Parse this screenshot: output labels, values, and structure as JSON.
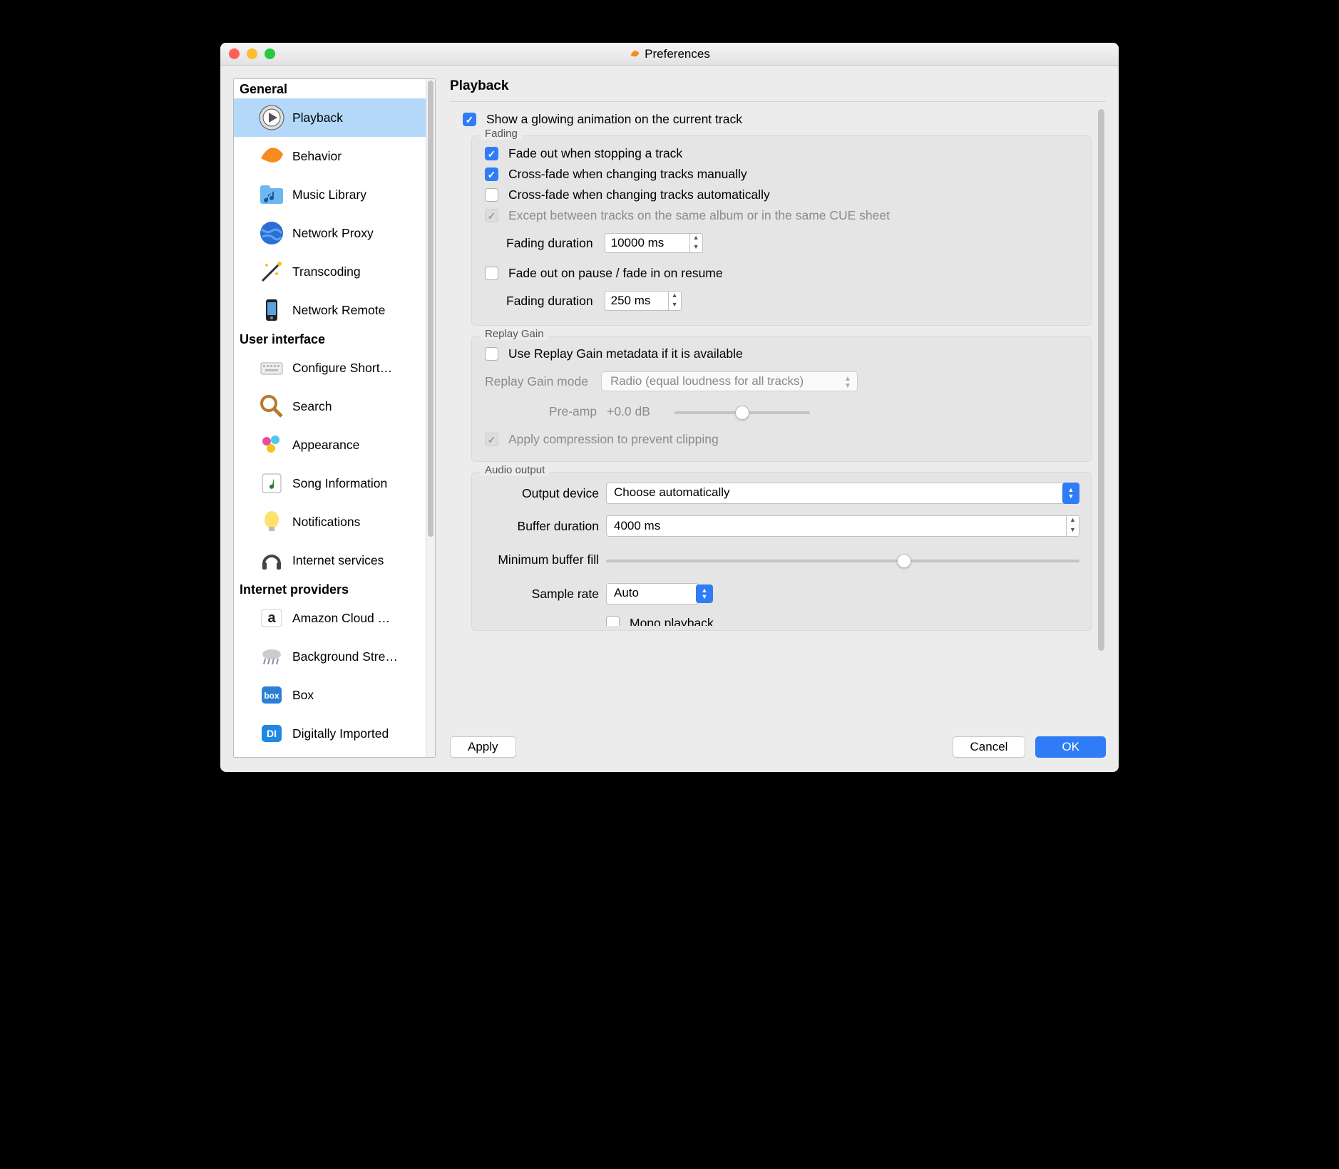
{
  "window": {
    "title": "Preferences"
  },
  "sidebar": {
    "cats": [
      {
        "name": "General",
        "items": [
          {
            "label": "Playback",
            "selected": true
          },
          {
            "label": "Behavior"
          },
          {
            "label": "Music Library"
          },
          {
            "label": "Network Proxy"
          },
          {
            "label": "Transcoding"
          },
          {
            "label": "Network Remote"
          }
        ]
      },
      {
        "name": "User interface",
        "items": [
          {
            "label": "Configure Short…"
          },
          {
            "label": "Search"
          },
          {
            "label": "Appearance"
          },
          {
            "label": "Song Information"
          },
          {
            "label": "Notifications"
          },
          {
            "label": "Internet services"
          }
        ]
      },
      {
        "name": "Internet providers",
        "items": [
          {
            "label": "Amazon Cloud …"
          },
          {
            "label": "Background Stre…"
          },
          {
            "label": "Box"
          },
          {
            "label": "Digitally Imported"
          }
        ]
      }
    ]
  },
  "main": {
    "title": "Playback",
    "glow": {
      "label": "Show a glowing animation on the current track",
      "checked": true
    },
    "fading": {
      "legend": "Fading",
      "stop": {
        "label": "Fade out when stopping a track",
        "checked": true
      },
      "man": {
        "label": "Cross-fade when changing tracks manually",
        "checked": true
      },
      "auto": {
        "label": "Cross-fade when changing tracks automatically",
        "checked": false
      },
      "except": {
        "label": "Except between tracks on the same album or in the same CUE sheet",
        "checked": true,
        "disabled": true
      },
      "dur1": {
        "label": "Fading duration",
        "value": "10000 ms"
      },
      "pause": {
        "label": "Fade out on pause / fade in on resume",
        "checked": false
      },
      "dur2": {
        "label": "Fading duration",
        "value": "250 ms"
      }
    },
    "replay": {
      "legend": "Replay Gain",
      "use": {
        "label": "Use Replay Gain metadata if it is available",
        "checked": false
      },
      "mode": {
        "label": "Replay Gain mode",
        "value": "Radio (equal loudness for all tracks)"
      },
      "preamp": {
        "label": "Pre-amp",
        "value": "+0.0 dB"
      },
      "slider_pos": 0.5,
      "comp": {
        "label": "Apply compression to prevent clipping",
        "checked": true,
        "disabled": true
      }
    },
    "audio": {
      "legend": "Audio output",
      "device": {
        "label": "Output device",
        "value": "Choose automatically"
      },
      "buffer": {
        "label": "Buffer duration",
        "value": "4000 ms"
      },
      "minfill": {
        "label": "Minimum buffer fill",
        "slider_pos": 0.63
      },
      "sample": {
        "label": "Sample rate",
        "value": "Auto"
      },
      "mono": {
        "label": "Mono playback",
        "checked": false
      }
    }
  },
  "buttons": {
    "apply": "Apply",
    "cancel": "Cancel",
    "ok": "OK"
  }
}
